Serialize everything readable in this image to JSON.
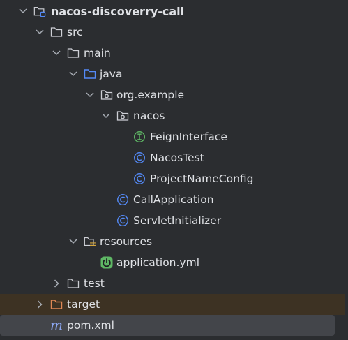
{
  "project_tree": {
    "items": [
      {
        "label": "nacos-discoverry-call",
        "expanded": true,
        "icon": "module-folder-icon"
      },
      {
        "label": "src",
        "expanded": true,
        "icon": "folder-icon"
      },
      {
        "label": "main",
        "expanded": true,
        "icon": "folder-icon"
      },
      {
        "label": "java",
        "expanded": true,
        "icon": "source-root-folder-icon"
      },
      {
        "label": "org.example",
        "expanded": true,
        "icon": "package-icon"
      },
      {
        "label": "nacos",
        "expanded": true,
        "icon": "package-icon"
      },
      {
        "label": "FeignInterface",
        "icon": "interface-icon"
      },
      {
        "label": "NacosTest",
        "icon": "class-icon"
      },
      {
        "label": "ProjectNameConfig",
        "icon": "class-icon"
      },
      {
        "label": "CallApplication",
        "icon": "class-icon"
      },
      {
        "label": "ServletInitializer",
        "icon": "class-icon"
      },
      {
        "label": "resources",
        "expanded": true,
        "icon": "resources-folder-icon"
      },
      {
        "label": "application.yml",
        "icon": "spring-config-icon"
      },
      {
        "label": "test",
        "expanded": false,
        "icon": "folder-icon"
      },
      {
        "label": "target",
        "expanded": false,
        "icon": "excluded-folder-icon"
      },
      {
        "label": "pom.xml",
        "icon": "maven-icon",
        "selected": true
      }
    ]
  },
  "colors": {
    "background": "#2b2d30",
    "text": "#dfe1e5",
    "chevron": "#a8adb5",
    "folder_outline": "#ced0d6",
    "source_root": "#548af7",
    "class_icon": "#548af7",
    "interface_icon": "#5fb865",
    "spring_icon": "#5fb865",
    "excluded_folder": "#e08855",
    "target_row_bg": "#3d3223",
    "selected_row_bg": "#43454a"
  }
}
